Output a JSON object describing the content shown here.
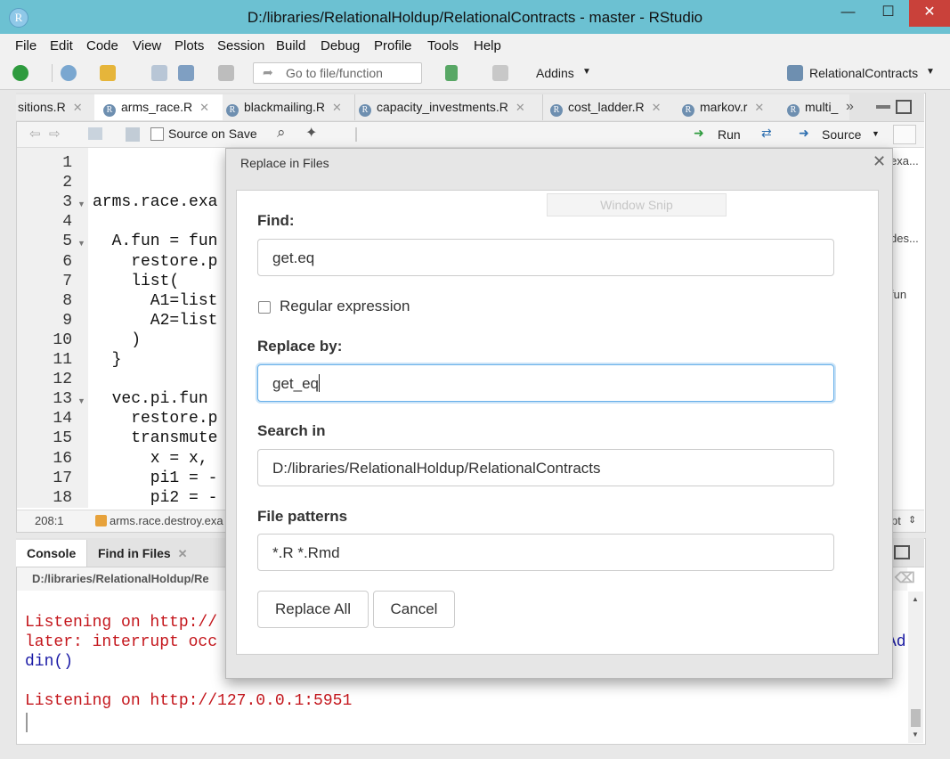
{
  "window": {
    "title": "D:/libraries/RelationalHoldup/RelationalContracts - master - RStudio",
    "app_icon_letter": "R",
    "minimize": "—",
    "maximize": "☐",
    "close": "✕"
  },
  "menu": [
    "File",
    "Edit",
    "Code",
    "View",
    "Plots",
    "Session",
    "Build",
    "Debug",
    "Profile",
    "Tools",
    "Help"
  ],
  "toolbar": {
    "goto_placeholder": "Go to file/function",
    "addins_label": "Addins",
    "project_label": "RelationalContracts"
  },
  "editor_tabs": [
    {
      "label": "sitions.R",
      "active": false
    },
    {
      "label": "arms_race.R",
      "active": true
    },
    {
      "label": "blackmailing.R",
      "active": false
    },
    {
      "label": "capacity_investments.R",
      "active": false
    },
    {
      "label": "cost_ladder.R",
      "active": false
    },
    {
      "label": "markov.r",
      "active": false
    },
    {
      "label": "multi_",
      "active": false
    }
  ],
  "editor_toolbar": {
    "source_on_save_label": "Source on Save",
    "run_label": "Run",
    "source_label": "Source"
  },
  "code_lines": [
    {
      "n": "1",
      "text": ""
    },
    {
      "n": "2",
      "text": ""
    },
    {
      "n": "3",
      "text": "arms.race.exa"
    },
    {
      "n": "4",
      "text": ""
    },
    {
      "n": "5",
      "text": "  A.fun = fun"
    },
    {
      "n": "6",
      "text": "    restore.p"
    },
    {
      "n": "7",
      "text": "    list("
    },
    {
      "n": "8",
      "text": "      A1=list"
    },
    {
      "n": "9",
      "text": "      A2=list"
    },
    {
      "n": "10",
      "text": "    )"
    },
    {
      "n": "11",
      "text": "  }"
    },
    {
      "n": "12",
      "text": ""
    },
    {
      "n": "13",
      "text": "  vec.pi.fun "
    },
    {
      "n": "14",
      "text": "    restore.p"
    },
    {
      "n": "15",
      "text": "    transmute"
    },
    {
      "n": "16",
      "text": "      x = x,"
    },
    {
      "n": "17",
      "text": "      pi1 = -"
    },
    {
      "n": "18",
      "text": "      pi2 = -"
    }
  ],
  "editor_status": {
    "position": "208:1",
    "function_label": "arms.race.destroy.exa",
    "script_type": "pt"
  },
  "right_outline": [
    "exa...",
    "des...",
    "fun"
  ],
  "console": {
    "tabs": [
      "Console",
      "Find in Files"
    ],
    "path": "D:/libraries/RelationalHoldup/Re",
    "lines": [
      {
        "text": "Listening on http://",
        "color": "red"
      },
      {
        "text": "later: interrupt occ",
        "color": "red"
      },
      {
        "text": "din()",
        "color": "blue"
      },
      {
        "text": "",
        "color": "red"
      },
      {
        "text": "Listening on http://127.0.0.1:5951",
        "color": "red"
      }
    ],
    "overflow_right": "Ad"
  },
  "dialog": {
    "title": "Replace in Files",
    "find_label": "Find:",
    "find_value": "get.eq",
    "regex_label": "Regular expression",
    "regex_checked": false,
    "replace_label": "Replace by:",
    "replace_value": "get_eq",
    "search_in_label": "Search in",
    "search_in_value": "D:/libraries/RelationalHoldup/RelationalContracts",
    "patterns_label": "File patterns",
    "patterns_value": "*.R *.Rmd",
    "replace_all_button": "Replace All",
    "cancel_button": "Cancel"
  },
  "overlay": {
    "window_snip": "Window Snip"
  },
  "colors": {
    "titlebar": "#6cc1d2",
    "close_button": "#c9413a",
    "console_error": "#c4161c",
    "console_message": "#1a1aa6"
  }
}
